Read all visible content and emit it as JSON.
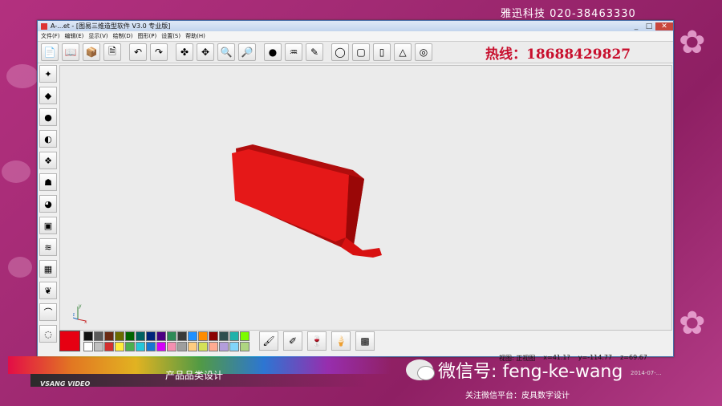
{
  "window": {
    "title": "A-...et - [图易三维造型软件 V3.0 专业版]",
    "controls": [
      "_",
      "□",
      "✕"
    ]
  },
  "menu": [
    "文件(F)",
    "编辑(E)",
    "显示(V)",
    "绘制(D)",
    "图形(P)",
    "设置(S)",
    "帮助(H)"
  ],
  "top_info": "雅迅科技  020-38463330",
  "hotline": "热线：18688429827",
  "palette": {
    "current_color": "#e60012",
    "swatches": [
      "#111111",
      "#5a5a5a",
      "#6a2a13",
      "#6b6b00",
      "#006400",
      "#006262",
      "#00247a",
      "#4b0082",
      "#2e8b57",
      "#3a3a3a",
      "#1e90ff",
      "#ff8c00",
      "#8b0000",
      "#2f4f4f",
      "#20b2aa",
      "#7cfc00",
      "#ffffff",
      "#c0c0c0",
      "#d32f2f",
      "#ffeb3b",
      "#4caf50",
      "#26c6da",
      "#1976d2",
      "#d500f9",
      "#f48fb1",
      "#9e9e9e",
      "#ffcc80",
      "#d4e157",
      "#ffab91",
      "#b39ddb",
      "#81d4fa",
      "#aed581"
    ]
  },
  "status": {
    "view": "视图: 正视图",
    "x": "x=41.1?",
    "y": "y=-114.77",
    "z": "z=69.67"
  },
  "bottom": {
    "subtitle": "产品品类设计",
    "brand": "VSANG VIDEO",
    "wechat": "微信号: feng-ke-wang",
    "follow": "关注微信平台：皮具数字设计",
    "date": "2014-07-..."
  },
  "axis_labels": {
    "y": "y",
    "z": "z",
    "x": "x"
  }
}
